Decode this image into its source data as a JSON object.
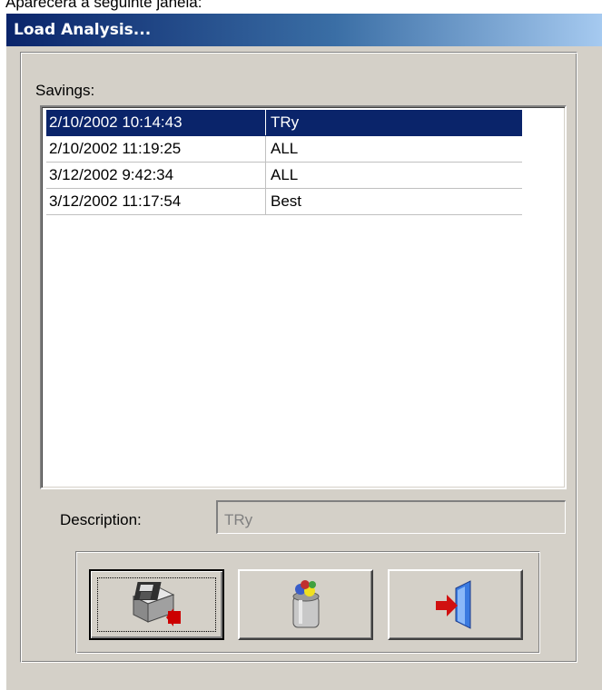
{
  "caption": "Aparecerá a seguinte janela:",
  "window": {
    "title": "Load Analysis..."
  },
  "savings": {
    "label": "Savings:",
    "rows": [
      {
        "date": "2/10/2002 10:14:43",
        "description": "TRy",
        "selected": true
      },
      {
        "date": "2/10/2002 11:19:25",
        "description": "ALL",
        "selected": false
      },
      {
        "date": "3/12/2002 9:42:34",
        "description": "ALL",
        "selected": false
      },
      {
        "date": "3/12/2002 11:17:54",
        "description": "Best",
        "selected": false
      }
    ]
  },
  "description": {
    "label": "Description:",
    "value": "TRy"
  },
  "toolbar": {
    "buttons": [
      {
        "icon": "load-analysis-icon",
        "default": true
      },
      {
        "icon": "trash-bin-icon",
        "default": false
      },
      {
        "icon": "exit-door-icon",
        "default": false
      }
    ]
  },
  "colors": {
    "selection": "#0a246a",
    "face": "#d4d0c8"
  }
}
